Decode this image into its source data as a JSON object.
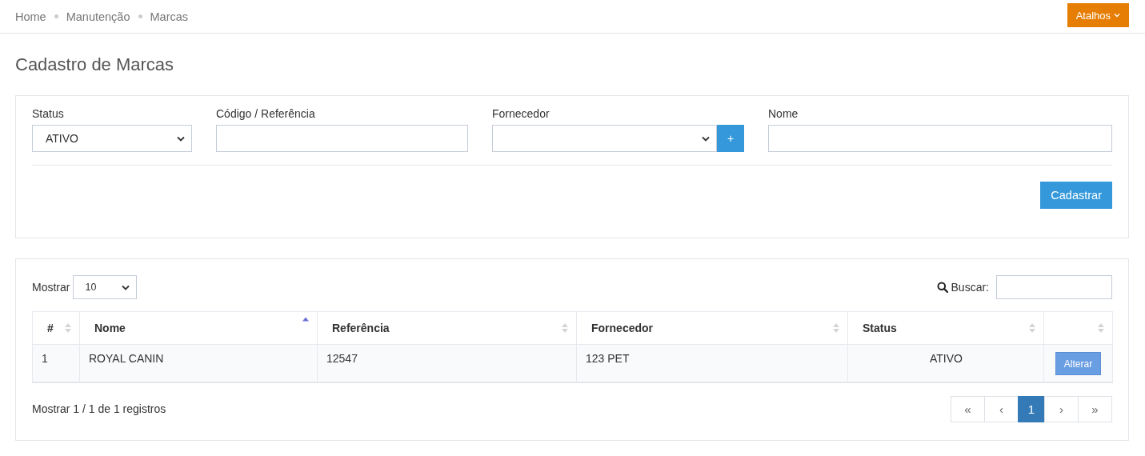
{
  "breadcrumb": [
    "Home",
    "Manutenção",
    "Marcas"
  ],
  "shortcuts_button": "Atalhos",
  "page_title": "Cadastro de Marcas",
  "form": {
    "fields": [
      {
        "kind": "select",
        "label": "Status",
        "value": "ATIVO"
      },
      {
        "kind": "input",
        "label": "Código / Referência"
      },
      {
        "kind": "select_add",
        "label": "Fornecedor",
        "add_button": "+"
      },
      {
        "kind": "input",
        "label": "Nome"
      }
    ],
    "submit_button": "Cadastrar"
  },
  "table": {
    "length_label": "Mostrar",
    "length_value": "10",
    "search_label": "Buscar:",
    "columns": [
      {
        "label": "#",
        "sorted_ascending": false
      },
      {
        "label": "Nome",
        "sorted_ascending": true
      },
      {
        "label": "Referência",
        "sorted_ascending": false
      },
      {
        "label": "Fornecedor",
        "sorted_ascending": false
      },
      {
        "label": "Status",
        "sorted_ascending": false
      },
      {
        "sorted_ascending": false
      }
    ],
    "rows": [
      {
        "cells": [
          "1",
          "ROYAL CANIN",
          "12547",
          "123 PET",
          "ATIVO"
        ],
        "action": "Alterar"
      }
    ],
    "info": "Mostrar 1 / 1 de 1 registros",
    "pagination": [
      {
        "label": "«",
        "selected": false
      },
      {
        "label": "‹",
        "selected": false
      },
      {
        "label": "1",
        "selected": true
      },
      {
        "label": "›",
        "selected": false
      },
      {
        "label": "»",
        "selected": false
      }
    ]
  }
}
